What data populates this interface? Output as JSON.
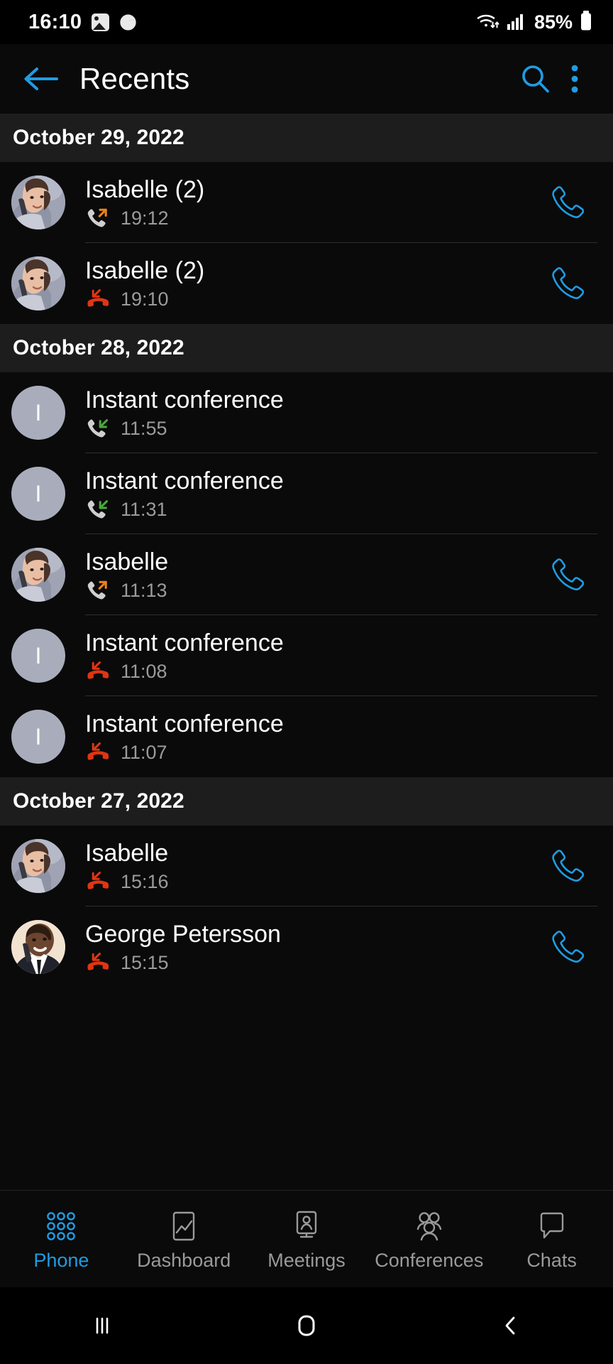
{
  "statusbar": {
    "time": "16:10",
    "battery_percent": "85%",
    "icons": [
      "gallery-icon",
      "app-badge-icon",
      "wifi-icon",
      "cellular-signal-icon",
      "battery-icon"
    ]
  },
  "appbar": {
    "title": "Recents",
    "back_label": "Back",
    "search_label": "Search",
    "overflow_label": "More options",
    "accent_color": "#1f9ce4"
  },
  "colors": {
    "accent": "#1f9ce4",
    "missed": "#e03512",
    "incoming": "#4aa83c",
    "outgoing": "#e8821a",
    "date_header_bg": "#1d1d1d",
    "background": "#0a0a0a",
    "avatar_placeholder": "#a9adbb"
  },
  "groups": [
    {
      "date": "October 29, 2022",
      "calls": [
        {
          "name": "Isabelle (2)",
          "time": "19:12",
          "type": "outgoing",
          "avatar": "photo-woman",
          "initial": "I",
          "action": "call-button"
        },
        {
          "name": "Isabelle (2)",
          "time": "19:10",
          "type": "missed",
          "avatar": "photo-woman",
          "initial": "I",
          "action": "call-button"
        }
      ]
    },
    {
      "date": "October 28, 2022",
      "calls": [
        {
          "name": "Instant conference",
          "time": "11:55",
          "type": "incoming",
          "avatar": "placeholder",
          "initial": "I",
          "action": "none"
        },
        {
          "name": "Instant conference",
          "time": "11:31",
          "type": "incoming",
          "avatar": "placeholder",
          "initial": "I",
          "action": "none"
        },
        {
          "name": "Isabelle",
          "time": "11:13",
          "type": "outgoing",
          "avatar": "photo-woman",
          "initial": "I",
          "action": "call-button"
        },
        {
          "name": "Instant conference",
          "time": "11:08",
          "type": "missed",
          "avatar": "placeholder",
          "initial": "I",
          "action": "none"
        },
        {
          "name": "Instant conference",
          "time": "11:07",
          "type": "missed",
          "avatar": "placeholder",
          "initial": "I",
          "action": "none"
        }
      ]
    },
    {
      "date": "October 27, 2022",
      "calls": [
        {
          "name": "Isabelle",
          "time": "15:16",
          "type": "missed",
          "avatar": "photo-woman",
          "initial": "I",
          "action": "call-button"
        },
        {
          "name": "George Petersson",
          "time": "15:15",
          "type": "missed",
          "avatar": "photo-man",
          "initial": "G",
          "action": "call-button"
        }
      ]
    }
  ],
  "bottomnav": {
    "active": "Phone",
    "items": [
      {
        "label": "Phone",
        "icon": "dialpad-icon"
      },
      {
        "label": "Dashboard",
        "icon": "chart-icon"
      },
      {
        "label": "Meetings",
        "icon": "person-monitor-icon"
      },
      {
        "label": "Conferences",
        "icon": "people-group-icon"
      },
      {
        "label": "Chats",
        "icon": "speech-bubble-icon"
      }
    ]
  },
  "sysnav": {
    "items": [
      {
        "label": "Recent apps",
        "icon": "recents-icon"
      },
      {
        "label": "Home",
        "icon": "home-icon"
      },
      {
        "label": "Back",
        "icon": "back-chevron-icon"
      }
    ]
  }
}
